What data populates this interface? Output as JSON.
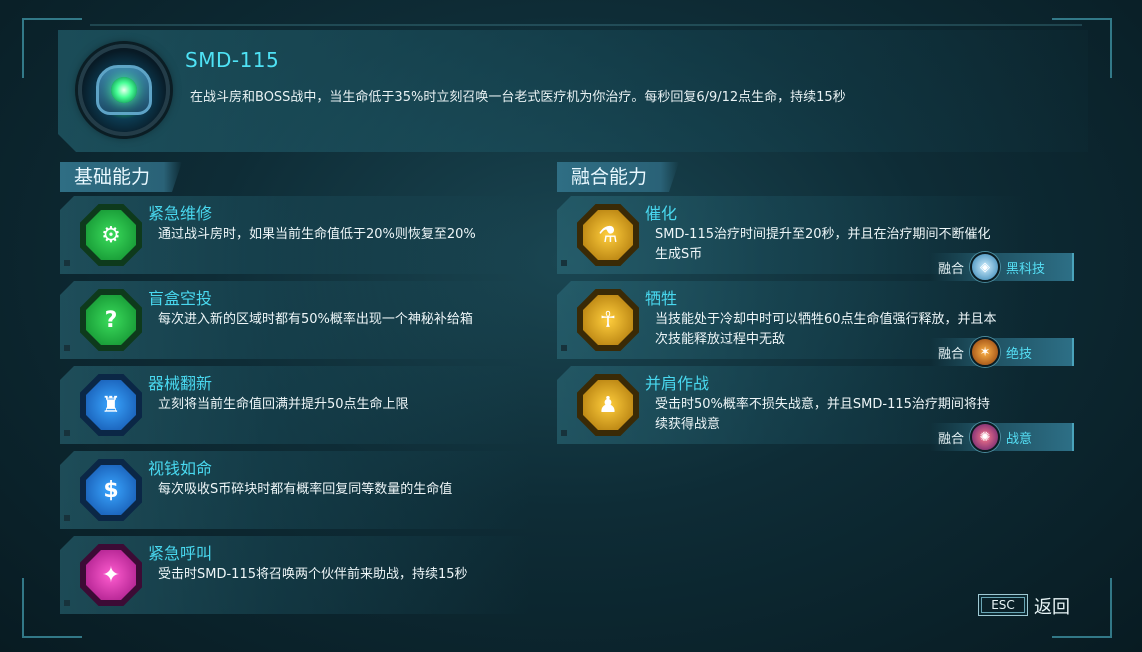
{
  "boss": {
    "name": "SMD-115",
    "description": "在战斗房和BOSS战中，当生命低于35%时立刻召唤一台老式医疗机为你治疗。每秒回复6/9/12点生命，持续15秒"
  },
  "basic": {
    "heading": "基础能力",
    "items": [
      {
        "title": "紧急维修",
        "desc": "通过战斗房时，如果当前生命值低于20%则恢复至20%",
        "icon": "gear-icon",
        "color": "green"
      },
      {
        "title": "盲盒空投",
        "desc": "每次进入新的区域时都有50%概率出现一个神秘补给箱",
        "icon": "mystery-box-icon",
        "color": "green"
      },
      {
        "title": "器械翻新",
        "desc": "立刻将当前生命值回满并提升50点生命上限",
        "icon": "robot-icon",
        "color": "blue"
      },
      {
        "title": "视钱如命",
        "desc": "每次吸收S币碎块时都有概率回复同等数量的生命值",
        "icon": "coin-icon",
        "color": "blue"
      },
      {
        "title": "紧急呼叫",
        "desc": "受击时SMD-115将召唤两个伙伴前来助战，持续15秒",
        "icon": "summon-icon",
        "color": "pink"
      }
    ]
  },
  "fusion": {
    "heading": "融合能力",
    "items": [
      {
        "title": "催化",
        "desc": "SMD-115治疗时间提升至20秒，并且在治疗期间不断催化生成S币",
        "icon": "catalyst-icon",
        "tag_label": "融合",
        "tag_name": "黑科技",
        "tag_icon": "cube-icon"
      },
      {
        "title": "牺牲",
        "desc": "当技能处于冷却中时可以牺牲60点生命值强行释放，并且本次技能释放过程中无敌",
        "icon": "sacrifice-icon",
        "tag_label": "融合",
        "tag_name": "绝技",
        "tag_icon": "warrior-icon"
      },
      {
        "title": "并肩作战",
        "desc": "受击时50%概率不损失战意，并且SMD-115治疗期间将持续获得战意",
        "icon": "allies-icon",
        "tag_label": "融合",
        "tag_name": "战意",
        "tag_icon": "mech-icon"
      }
    ]
  },
  "footer": {
    "esc": "ESC",
    "back": "返回"
  },
  "colors": {
    "accent": "#49d8ef",
    "title": "#4fe2f5",
    "panel": "#2f6e84"
  }
}
